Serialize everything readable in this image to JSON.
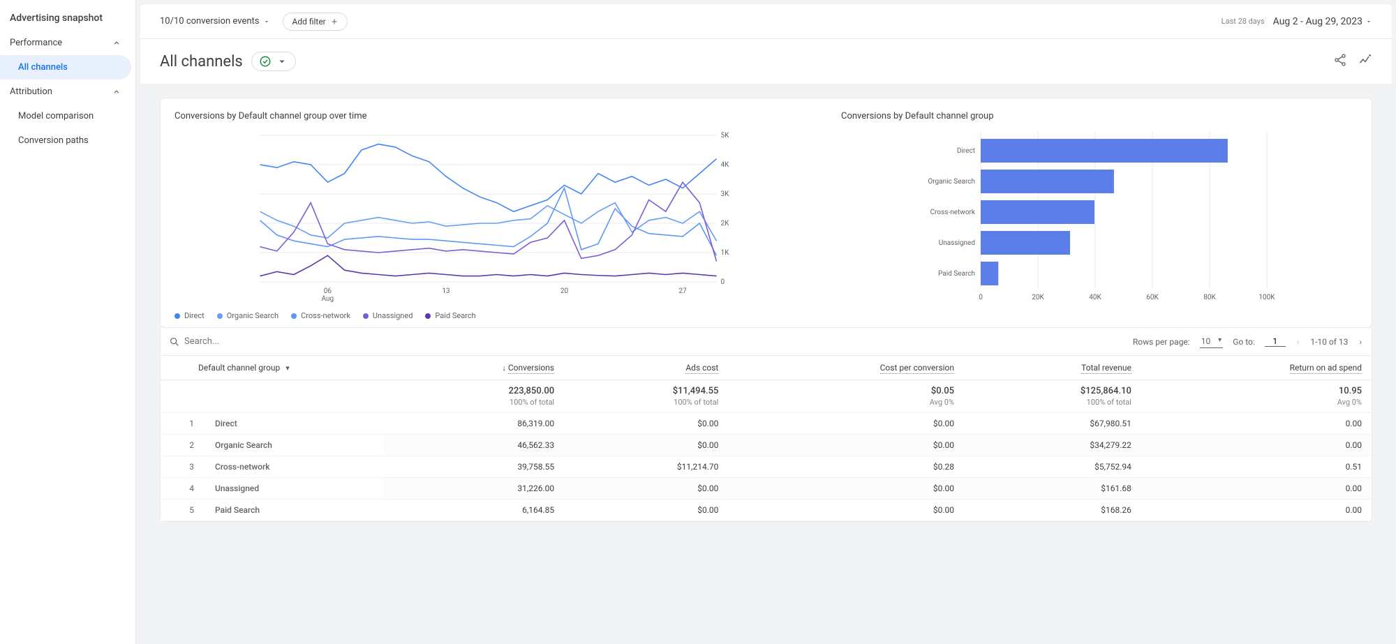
{
  "sidebar": {
    "title": "Advertising snapshot",
    "sections": [
      {
        "label": "Performance",
        "items": [
          {
            "label": "All channels",
            "active": true
          }
        ]
      },
      {
        "label": "Attribution",
        "items": [
          {
            "label": "Model comparison"
          },
          {
            "label": "Conversion paths"
          }
        ]
      }
    ]
  },
  "topbar": {
    "conversion_events": "10/10 conversion events",
    "add_filter": "Add filter",
    "date_label": "Last 28 days",
    "date_range": "Aug 2 - Aug 29, 2023"
  },
  "page": {
    "title": "All channels"
  },
  "line_chart": {
    "title": "Conversions by Default channel group over time",
    "x_ticks": [
      "06",
      "13",
      "20",
      "27"
    ],
    "x_sub": "Aug",
    "y_ticks": [
      "0",
      "1K",
      "2K",
      "3K",
      "4K",
      "5K"
    ]
  },
  "bar_chart": {
    "title": "Conversions by Default channel group",
    "x_ticks": [
      "0",
      "20K",
      "40K",
      "60K",
      "80K",
      "100K"
    ],
    "categories": [
      "Direct",
      "Organic Search",
      "Cross-network",
      "Unassigned",
      "Paid Search"
    ]
  },
  "legend": [
    {
      "label": "Direct",
      "color": "#4285f4"
    },
    {
      "label": "Organic Search",
      "color": "#669df6"
    },
    {
      "label": "Cross-network",
      "color": "#5e97f6"
    },
    {
      "label": "Unassigned",
      "color": "#7b5dd6"
    },
    {
      "label": "Paid Search",
      "color": "#5e35b1"
    }
  ],
  "chart_data": [
    {
      "type": "line",
      "title": "Conversions by Default channel group over time",
      "xlabel": "Aug",
      "ylabel": "",
      "ylim": [
        0,
        5000
      ],
      "x": [
        "02",
        "03",
        "04",
        "05",
        "06",
        "07",
        "08",
        "09",
        "10",
        "11",
        "12",
        "13",
        "14",
        "15",
        "16",
        "17",
        "18",
        "19",
        "20",
        "21",
        "22",
        "23",
        "24",
        "25",
        "26",
        "27",
        "28",
        "29"
      ],
      "series": [
        {
          "name": "Direct",
          "values": [
            4000,
            3900,
            4100,
            4000,
            3400,
            3700,
            4500,
            4700,
            4600,
            4300,
            4100,
            3600,
            3200,
            2900,
            2700,
            2400,
            2600,
            2800,
            3300,
            3000,
            3700,
            3400,
            3600,
            3300,
            3500,
            3200,
            3700,
            4200
          ]
        },
        {
          "name": "Organic Search",
          "values": [
            2400,
            2100,
            1900,
            1600,
            1500,
            2000,
            2100,
            2200,
            2100,
            2000,
            2050,
            1900,
            1950,
            2000,
            2000,
            2100,
            2150,
            2600,
            2300,
            2000,
            2400,
            2700,
            1700,
            2100,
            2200,
            2000,
            2400,
            1400
          ]
        },
        {
          "name": "Cross-network",
          "values": [
            2100,
            1600,
            1400,
            1300,
            1200,
            1450,
            1500,
            1550,
            1500,
            1450,
            1450,
            1400,
            1350,
            1300,
            1250,
            1200,
            1550,
            2000,
            3200,
            1100,
            1300,
            2500,
            1900,
            1650,
            1600,
            1550,
            2000,
            900
          ]
        },
        {
          "name": "Unassigned",
          "values": [
            1200,
            1050,
            1700,
            2700,
            1300,
            1100,
            1050,
            1000,
            1050,
            1100,
            1150,
            1050,
            1100,
            1050,
            1000,
            950,
            1350,
            1500,
            2100,
            800,
            900,
            1100,
            1600,
            2800,
            2400,
            3400,
            2700,
            700
          ]
        },
        {
          "name": "Paid Search",
          "values": [
            200,
            350,
            250,
            550,
            900,
            400,
            300,
            250,
            200,
            250,
            300,
            250,
            200,
            200,
            250,
            200,
            250,
            200,
            300,
            250,
            220,
            200,
            250,
            300,
            250,
            300,
            250,
            200
          ]
        }
      ]
    },
    {
      "type": "bar",
      "title": "Conversions by Default channel group",
      "orientation": "horizontal",
      "xlim": [
        0,
        100000
      ],
      "categories": [
        "Direct",
        "Organic Search",
        "Cross-network",
        "Unassigned",
        "Paid Search"
      ],
      "values": [
        86319,
        46562,
        39759,
        31226,
        6165
      ]
    }
  ],
  "table": {
    "dimension": "Default channel group",
    "search_placeholder": "Search...",
    "rows_per_page_label": "Rows per page:",
    "rows_per_page": "10",
    "goto_label": "Go to:",
    "goto_value": "1",
    "range": "1-10 of 13",
    "columns": [
      "Conversions",
      "Ads cost",
      "Cost per conversion",
      "Total revenue",
      "Return on ad spend"
    ],
    "totals": {
      "values": [
        "223,850.00",
        "$11,494.55",
        "$0.05",
        "$125,864.10",
        "10.95"
      ],
      "subs": [
        "100% of total",
        "100% of total",
        "Avg 0%",
        "100% of total",
        "Avg 0%"
      ]
    },
    "rows": [
      {
        "idx": "1",
        "name": "Direct",
        "v": [
          "86,319.00",
          "$0.00",
          "$0.00",
          "$67,980.51",
          "0.00"
        ]
      },
      {
        "idx": "2",
        "name": "Organic Search",
        "v": [
          "46,562.33",
          "$0.00",
          "$0.00",
          "$34,279.22",
          "0.00"
        ]
      },
      {
        "idx": "3",
        "name": "Cross-network",
        "v": [
          "39,758.55",
          "$11,214.70",
          "$0.28",
          "$5,752.94",
          "0.51"
        ]
      },
      {
        "idx": "4",
        "name": "Unassigned",
        "v": [
          "31,226.00",
          "$0.00",
          "$0.00",
          "$161.68",
          "0.00"
        ]
      },
      {
        "idx": "5",
        "name": "Paid Search",
        "v": [
          "6,164.85",
          "$0.00",
          "$0.00",
          "$168.26",
          "0.00"
        ]
      }
    ]
  }
}
